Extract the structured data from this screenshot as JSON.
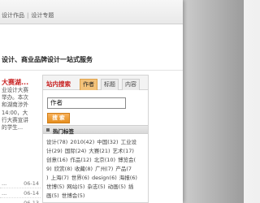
{
  "header": {
    "nav": [
      "设计作品",
      "设计专题"
    ],
    "separator": "|"
  },
  "slogan": "设计、商业品牌设计一站式服务",
  "article": {
    "title": "大赛湖...",
    "lines": [
      "业设计大赛",
      "举办。本次",
      "和湖南涉外",
      "14:00，大",
      "行大赛宣讲",
      "的学生..."
    ]
  },
  "news": [
    {
      "title": "...",
      "date": "06-14"
    },
    {
      "title": "...",
      "date": "06-14"
    },
    {
      "title": "...",
      "date": "06-13"
    }
  ],
  "search_panel": {
    "label": "站内搜索",
    "tabs": [
      "作者",
      "标题",
      "内容"
    ],
    "active_tab": "作者",
    "input_value": "作者",
    "button_label": "搜 索"
  },
  "hot_tags": {
    "title": "热门标签",
    "rows": [
      [
        "设计(78)",
        "2010(42)",
        "中国(32)",
        "工业设"
      ],
      [
        "计(29)",
        "国际(24)",
        "大赛(21)",
        "艺术(17)"
      ],
      [
        "创意(16)",
        "作品(12)",
        "北京(10)",
        "博览会("
      ],
      [
        "9)",
        "欣赏(8)",
        "收藏(8)",
        "广州(7)",
        "产品(7"
      ],
      [
        ")",
        "上海(7)",
        "世界(6)",
        "design(6)",
        "海报(6)"
      ],
      [
        "世博(5)",
        "网站(5)",
        "杂志(5)",
        "动画(5)",
        "插"
      ],
      [
        "画(5)",
        "世博会(5)"
      ]
    ]
  }
}
